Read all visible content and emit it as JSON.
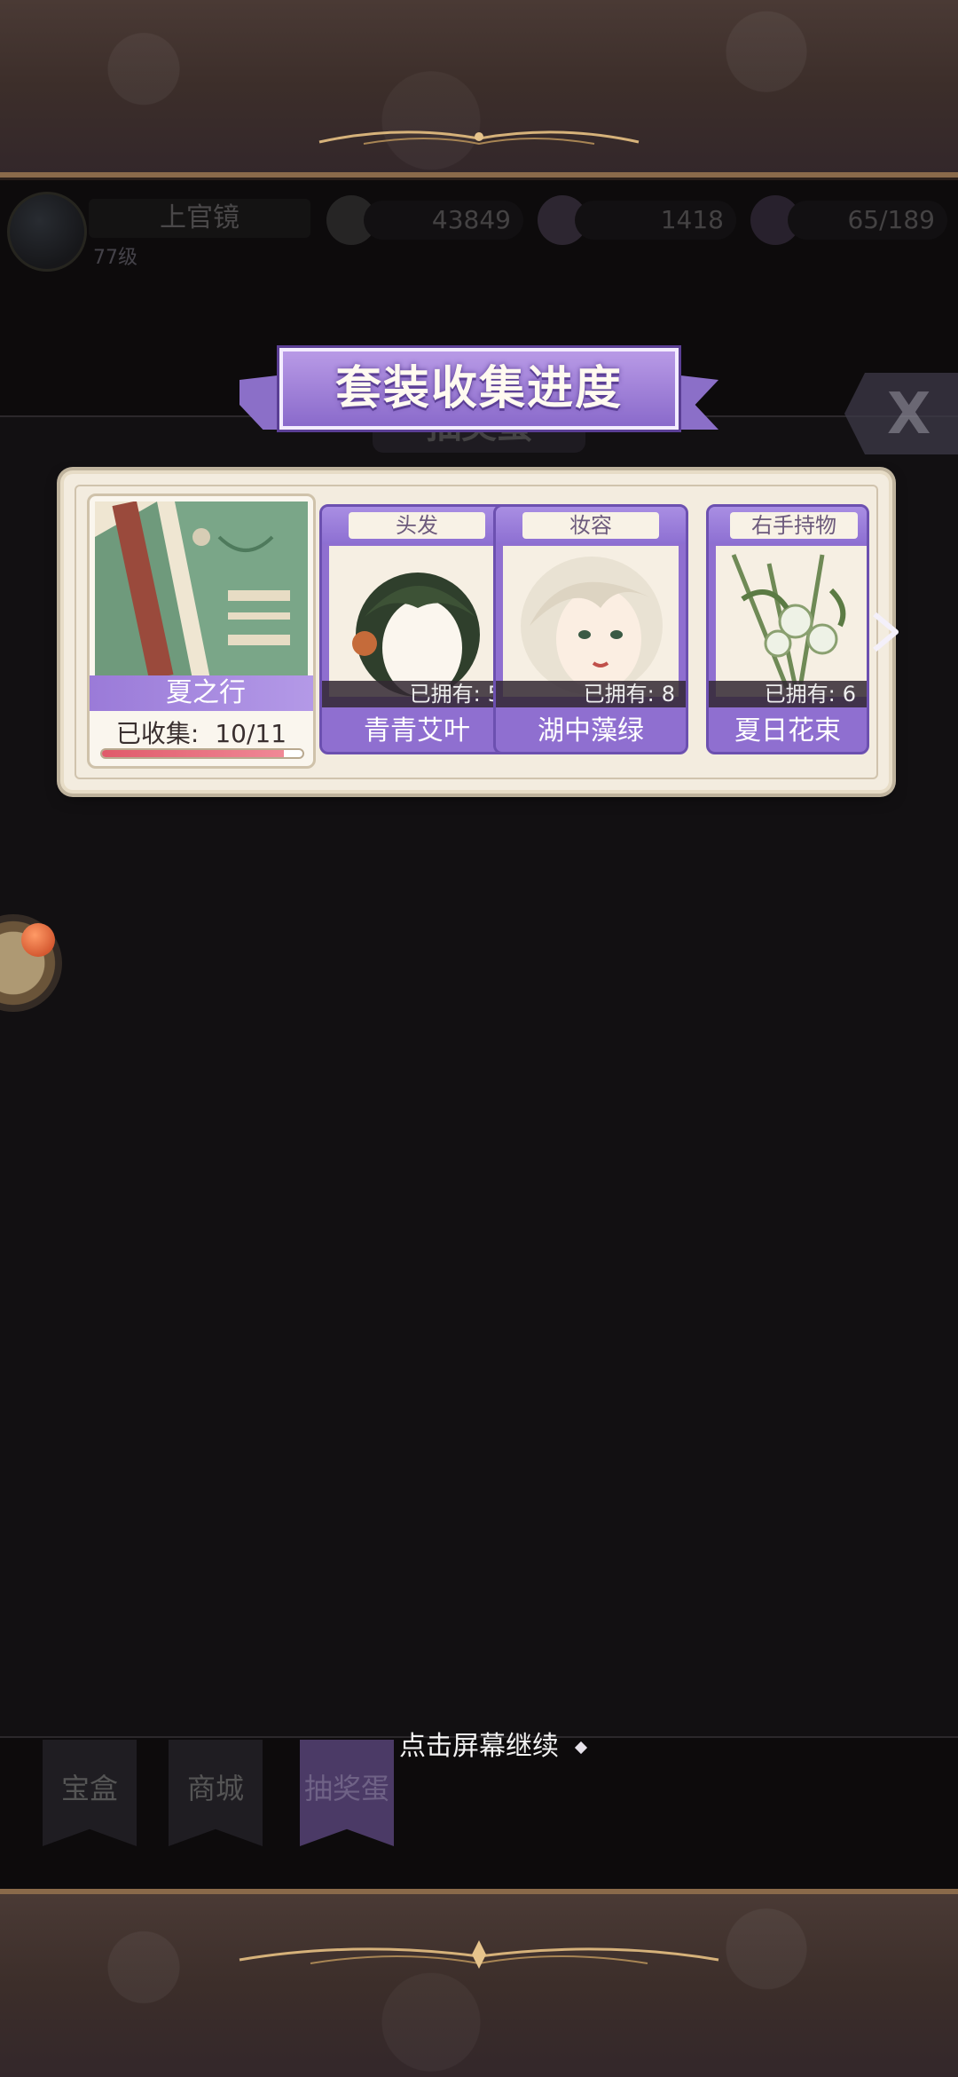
{
  "hud": {
    "player_name": "上官镜",
    "level": "77级",
    "resources": [
      {
        "icon": "coin-icon",
        "value": "43849"
      },
      {
        "icon": "diamond-icon",
        "value": "1418"
      },
      {
        "icon": "stamina-icon",
        "value": "65/189"
      }
    ]
  },
  "background_tab_title": "抽奖蛋",
  "dialog": {
    "title": "套装收集进度",
    "suit": {
      "name": "夏之行",
      "progress_label": "已收集:",
      "progress_value": "10/11",
      "progress_fraction": 0.909
    },
    "items": [
      {
        "category": "头发",
        "owned_label": "已拥有:",
        "owned_count": "5",
        "name": "青青艾叶"
      },
      {
        "category": "妆容",
        "owned_label": "已拥有:",
        "owned_count": "8",
        "name": "湖中藻绿"
      },
      {
        "category": "右手持物",
        "owned_label": "已拥有:",
        "owned_count": "6",
        "name": "夏日花束"
      }
    ]
  },
  "hint": "点击屏幕继续",
  "bottom_nav": [
    {
      "label": "宝盒",
      "active": false
    },
    {
      "label": "商城",
      "active": false
    },
    {
      "label": "抽奖蛋",
      "active": true
    }
  ],
  "colors": {
    "accent_purple": "#8f6fd0",
    "parchment": "#f3ecdf",
    "progress_red": "#e05a6a"
  }
}
